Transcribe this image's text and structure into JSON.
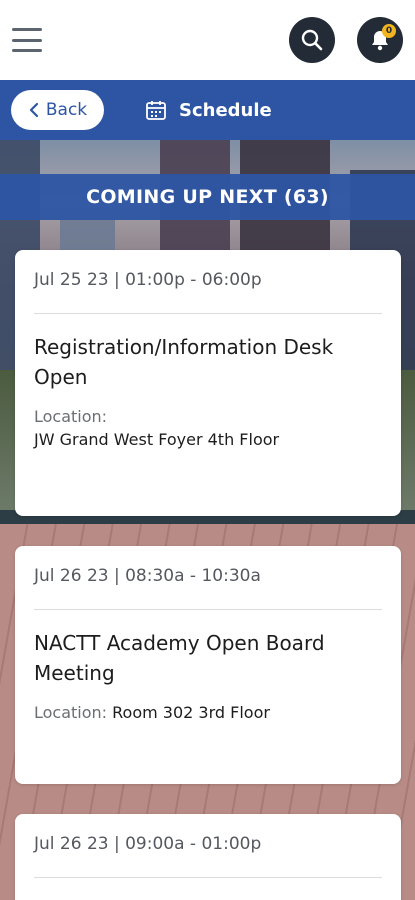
{
  "topbar": {
    "menu_icon": "hamburger-menu-icon",
    "search_icon": "search-icon",
    "notifications_icon": "bell-icon",
    "notification_count": "0",
    "dark_color": "#232b36",
    "badge_color": "#f2b51e"
  },
  "subbar": {
    "back_label": "Back",
    "title": "Schedule",
    "title_icon": "calendar-icon",
    "accent_color": "#2d55a4"
  },
  "section": {
    "heading": "COMING UP NEXT (63)"
  },
  "events": [
    {
      "date": "Jul 25 23 | 01:00p - 06:00p",
      "title": "Registration/Information Desk Open",
      "location_label": "Location:",
      "location": "JW Grand West Foyer 4th Floor"
    },
    {
      "date": "Jul 26 23 | 08:30a - 10:30a",
      "title": "NACTT Academy Open Board Meeting",
      "location_label": "Location:",
      "location": "Room 302 3rd Floor"
    },
    {
      "date": "Jul 26 23 | 09:00a - 01:00p"
    }
  ]
}
